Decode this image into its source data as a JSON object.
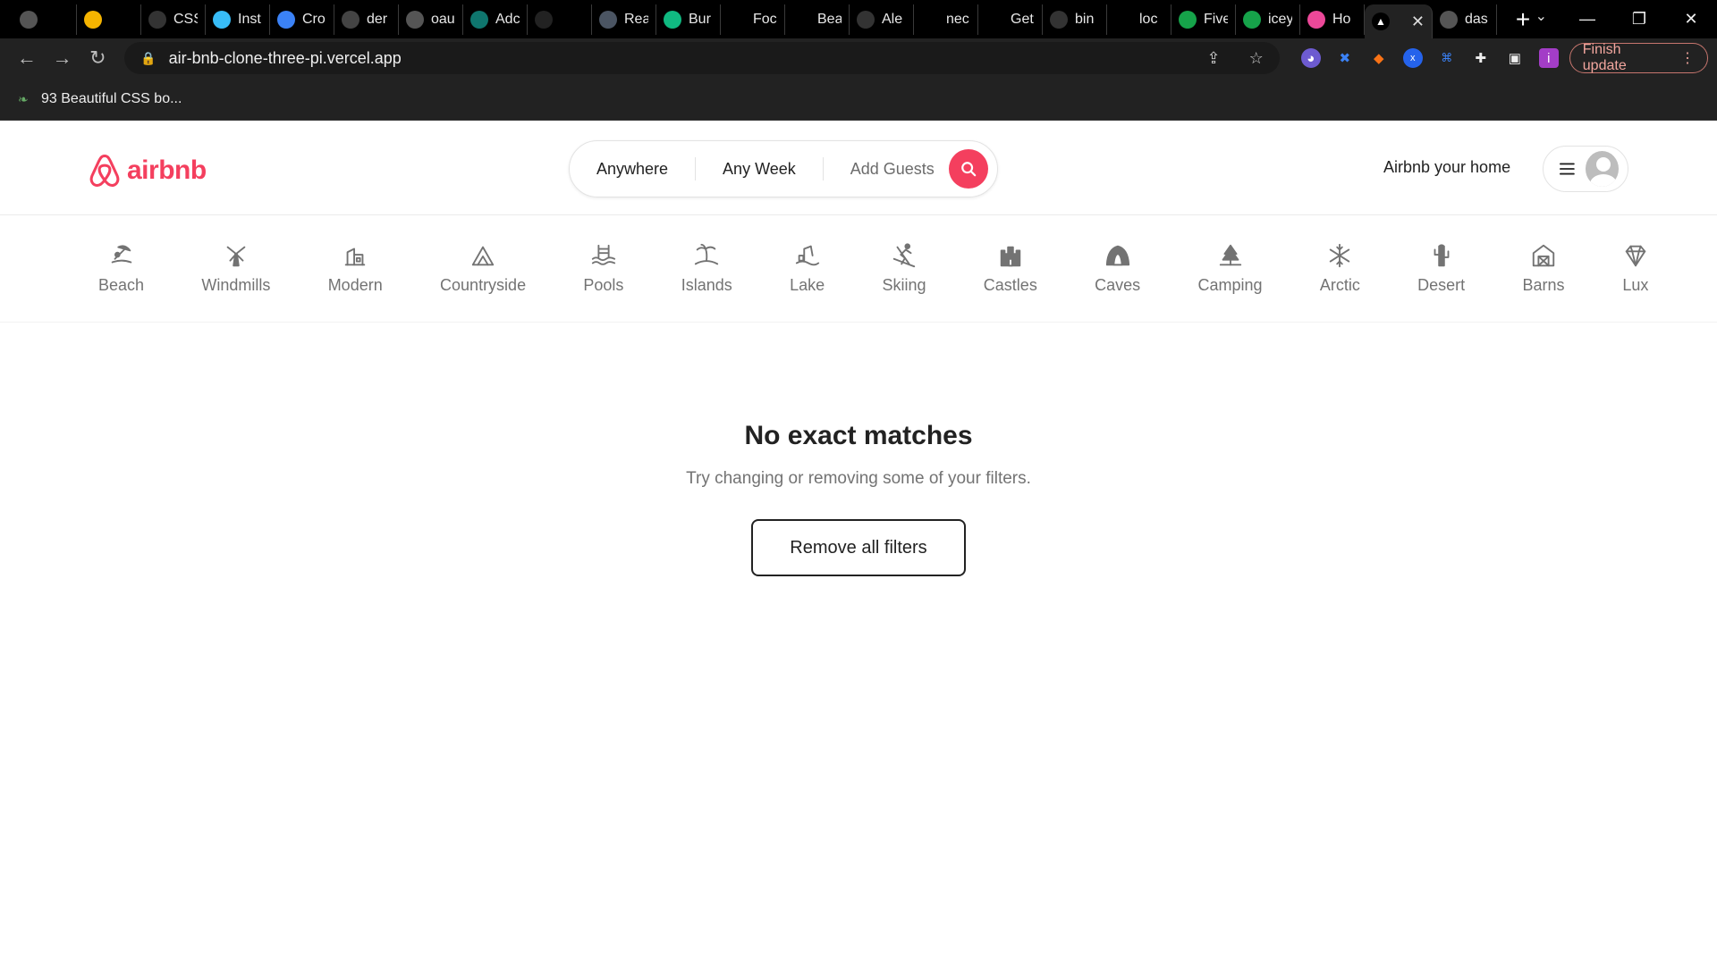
{
  "browser": {
    "tabs": [
      {
        "label": "",
        "color": "#555"
      },
      {
        "label": "",
        "color": "#f5b400"
      },
      {
        "label": "CSS",
        "color": "#333"
      },
      {
        "label": "Inst",
        "color": "#38bdf8"
      },
      {
        "label": "Cro",
        "color": "#3b82f6"
      },
      {
        "label": "der",
        "color": "#444"
      },
      {
        "label": "oau",
        "color": "#555"
      },
      {
        "label": "Adc",
        "color": "#0f766e"
      },
      {
        "label": "",
        "color": "#222"
      },
      {
        "label": "Rea",
        "color": "#4b5563"
      },
      {
        "label": "Bur",
        "color": "#10b981"
      },
      {
        "label": "Foc",
        "color": "#000"
      },
      {
        "label": "Bea",
        "color": "#000"
      },
      {
        "label": "Ale",
        "color": "#333"
      },
      {
        "label": "nec",
        "color": "#000"
      },
      {
        "label": "Get",
        "color": "#000"
      },
      {
        "label": "bin",
        "color": "#333"
      },
      {
        "label": "loc",
        "color": "#000"
      },
      {
        "label": "Five",
        "color": "#16a34a"
      },
      {
        "label": "icey",
        "color": "#16a34a"
      },
      {
        "label": "Ho",
        "color": "#ec4899"
      },
      {
        "label": "",
        "color": "#000",
        "active": true
      },
      {
        "label": "das",
        "color": "#555"
      }
    ],
    "url": "air-bnb-clone-three-pi.vercel.app",
    "profile_initial": "i",
    "finish_update_label": "Finish update",
    "bookmark_label": "93 Beautiful CSS bo..."
  },
  "header": {
    "logo_text": "airbnb",
    "brand_color": "#f43f5e",
    "search": {
      "location": "Anywhere",
      "week": "Any Week",
      "guests": "Add Guests"
    },
    "host_label": "Airbnb your home"
  },
  "categories": [
    {
      "label": "Beach",
      "icon": "beach-icon"
    },
    {
      "label": "Windmills",
      "icon": "windmill-icon"
    },
    {
      "label": "Modern",
      "icon": "modern-icon"
    },
    {
      "label": "Countryside",
      "icon": "mountain-icon"
    },
    {
      "label": "Pools",
      "icon": "pool-icon"
    },
    {
      "label": "Islands",
      "icon": "island-icon"
    },
    {
      "label": "Lake",
      "icon": "lake-icon"
    },
    {
      "label": "Skiing",
      "icon": "skiing-icon"
    },
    {
      "label": "Castles",
      "icon": "castle-icon"
    },
    {
      "label": "Caves",
      "icon": "cave-icon"
    },
    {
      "label": "Camping",
      "icon": "camping-icon"
    },
    {
      "label": "Arctic",
      "icon": "snowflake-icon"
    },
    {
      "label": "Desert",
      "icon": "cactus-icon"
    },
    {
      "label": "Barns",
      "icon": "barn-icon"
    },
    {
      "label": "Lux",
      "icon": "diamond-icon"
    }
  ],
  "empty_state": {
    "title": "No exact matches",
    "subtitle": "Try changing or removing some of your filters.",
    "button_label": "Remove all filters"
  }
}
